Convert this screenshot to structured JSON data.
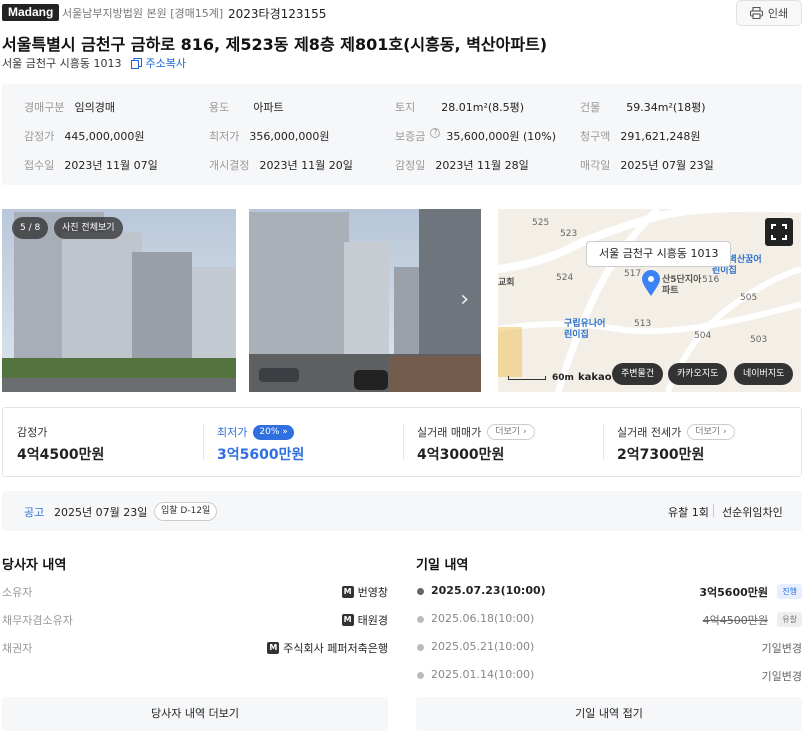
{
  "header": {
    "logo": "Madang",
    "court": "서울남부지방법원 본원 [경매15계]",
    "case_no": "2023타경123155",
    "print_label": "인쇄"
  },
  "property": {
    "title": "서울특별시 금천구 금하로 816, 제523동 제8층 제801호(시흥동, 벽산아파트)",
    "lot_address": "서울 금천구 시흥동 1013",
    "copy_label": "주소복사"
  },
  "info": {
    "auction_type_label": "경매구분",
    "auction_type": "임의경매",
    "use_label": "용도",
    "use": "아파트",
    "land_label": "토지",
    "land": "28.01m²(8.5평)",
    "building_label": "건물",
    "building": "59.34m²(18평)",
    "appraisal_label": "감정가",
    "appraisal": "445,000,000원",
    "minimum_label": "최저가",
    "minimum": "356,000,000원",
    "deposit_label": "보증금",
    "deposit": "35,600,000원 (10%)",
    "claim_label": "청구액",
    "claim": "291,621,248원",
    "received_label": "접수일",
    "received": "2023년 11월 07일",
    "commence_label": "개시결정",
    "commence": "2023년 11월 20일",
    "appraisal_date_label": "감정일",
    "appraisal_date": "2023년 11월 28일",
    "sale_date_label": "매각일",
    "sale_date": "2025년 07월 23일"
  },
  "photos": {
    "counter": "5 / 8",
    "view_all": "사진 전체보기"
  },
  "map": {
    "address_label": "서울 금천구 시흥동 1013",
    "numbers": [
      "525",
      "523",
      "524",
      "517",
      "516",
      "505",
      "513",
      "504",
      "503"
    ],
    "poi_1": "구립벽산꿈어린이집",
    "poi_2": "구립유나어린이집",
    "poi_3": "산5단지아파트",
    "poi_4": "교회",
    "scale": "60m",
    "brand": "kakao",
    "btn_nearby": "주변물건",
    "btn_kakao": "카카오지도",
    "btn_naver": "네이버지도"
  },
  "prices": {
    "appraisal_label": "감정가",
    "appraisal": "4억4500만원",
    "minimum_label": "최저가",
    "minimum_pct": "20%",
    "minimum": "3억5600만원",
    "trade_label": "실거래 매매가",
    "trade_more": "더보기",
    "trade": "4억3000만원",
    "jeonse_label": "실거래 전세가",
    "jeonse_more": "더보기",
    "jeonse": "2억7300만원"
  },
  "notice": {
    "label": "공고",
    "date": "2025년 07월 23일",
    "dday": "입찰 D-12일",
    "fails": "유찰 1회",
    "right": "선순위임차인"
  },
  "parties": {
    "title": "당사자 내역",
    "rows": [
      {
        "role": "소유자",
        "name": "번영창"
      },
      {
        "role": "채무자겸소유자",
        "name": "태원경"
      },
      {
        "role": "채권자",
        "name": "주식회사 페퍼저축은행"
      }
    ],
    "more_button": "당사자 내역 더보기"
  },
  "history": {
    "title": "기일 내역",
    "rows": [
      {
        "date": "2025.07.23(10:00)",
        "price": "3억5600만원",
        "status": "진행"
      },
      {
        "date": "2025.06.18(10:00)",
        "price": "4억4500만원",
        "status": "유찰"
      },
      {
        "date": "2025.05.21(10:00)",
        "price": "",
        "status": "기일변경"
      },
      {
        "date": "2025.01.14(10:00)",
        "price": "",
        "status": "기일변경"
      }
    ],
    "collapse_button": "기일 내역 접기"
  },
  "colors": {
    "accent": "#2f6fe0",
    "marker": "#3b82f6"
  }
}
